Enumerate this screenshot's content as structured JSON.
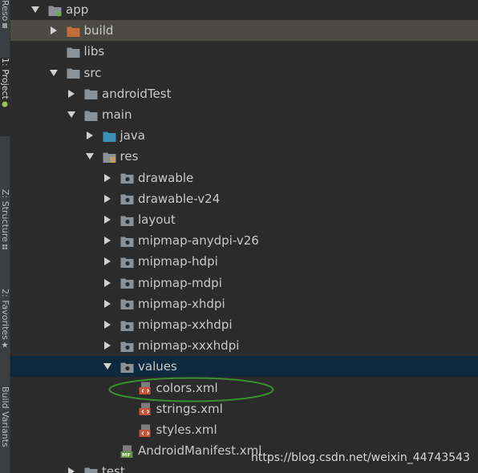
{
  "side_tabs": {
    "resource_manager": "Reso",
    "project": "1: Project",
    "structure": "Z: Structure",
    "favorites": "2: Favorites",
    "build_variants": "Build Variants"
  },
  "tree": [
    {
      "label": "app",
      "depth": 0,
      "expanded": true,
      "icon": "module-folder-icon"
    },
    {
      "label": "build",
      "depth": 1,
      "expanded": false,
      "icon": "build-folder-icon"
    },
    {
      "label": "libs",
      "depth": 1,
      "expanded": null,
      "icon": "folder-icon"
    },
    {
      "label": "src",
      "depth": 1,
      "expanded": true,
      "icon": "folder-icon"
    },
    {
      "label": "androidTest",
      "depth": 2,
      "expanded": false,
      "icon": "folder-icon"
    },
    {
      "label": "main",
      "depth": 2,
      "expanded": true,
      "icon": "folder-icon"
    },
    {
      "label": "java",
      "depth": 3,
      "expanded": false,
      "icon": "source-folder-icon"
    },
    {
      "label": "res",
      "depth": 3,
      "expanded": true,
      "icon": "resource-root-icon"
    },
    {
      "label": "drawable",
      "depth": 4,
      "expanded": false,
      "icon": "resource-folder-icon"
    },
    {
      "label": "drawable-v24",
      "depth": 4,
      "expanded": false,
      "icon": "resource-folder-icon"
    },
    {
      "label": "layout",
      "depth": 4,
      "expanded": false,
      "icon": "resource-folder-icon"
    },
    {
      "label": "mipmap-anydpi-v26",
      "depth": 4,
      "expanded": false,
      "icon": "resource-folder-icon"
    },
    {
      "label": "mipmap-hdpi",
      "depth": 4,
      "expanded": false,
      "icon": "resource-folder-icon"
    },
    {
      "label": "mipmap-mdpi",
      "depth": 4,
      "expanded": false,
      "icon": "resource-folder-icon"
    },
    {
      "label": "mipmap-xhdpi",
      "depth": 4,
      "expanded": false,
      "icon": "resource-folder-icon"
    },
    {
      "label": "mipmap-xxhdpi",
      "depth": 4,
      "expanded": false,
      "icon": "resource-folder-icon"
    },
    {
      "label": "mipmap-xxxhdpi",
      "depth": 4,
      "expanded": false,
      "icon": "resource-folder-icon"
    },
    {
      "label": "values",
      "depth": 4,
      "expanded": true,
      "icon": "resource-folder-icon"
    },
    {
      "label": "colors.xml",
      "depth": 5,
      "expanded": null,
      "icon": "xml-file-icon"
    },
    {
      "label": "strings.xml",
      "depth": 5,
      "expanded": null,
      "icon": "xml-file-icon"
    },
    {
      "label": "styles.xml",
      "depth": 5,
      "expanded": null,
      "icon": "xml-file-icon"
    },
    {
      "label": "AndroidManifest.xml",
      "depth": 4,
      "expanded": null,
      "icon": "manifest-file-icon"
    },
    {
      "label": "test",
      "depth": 2,
      "expanded": false,
      "icon": "folder-icon"
    }
  ],
  "highlighted_rows": {
    "build": "#4b4a43",
    "values": "#0d293e"
  },
  "annotation": {
    "circled_item": "colors.xml",
    "color": "#3a8f2f"
  },
  "watermark": "https://blog.csdn.net/weixin_44743543",
  "colors": {
    "background": "#2b2b2b",
    "text": "#c9c9c9",
    "folder": "#8a9297",
    "build_folder": "#c26e3a",
    "source_folder": "#3c8fb5",
    "xml_file": "#c4553a"
  }
}
